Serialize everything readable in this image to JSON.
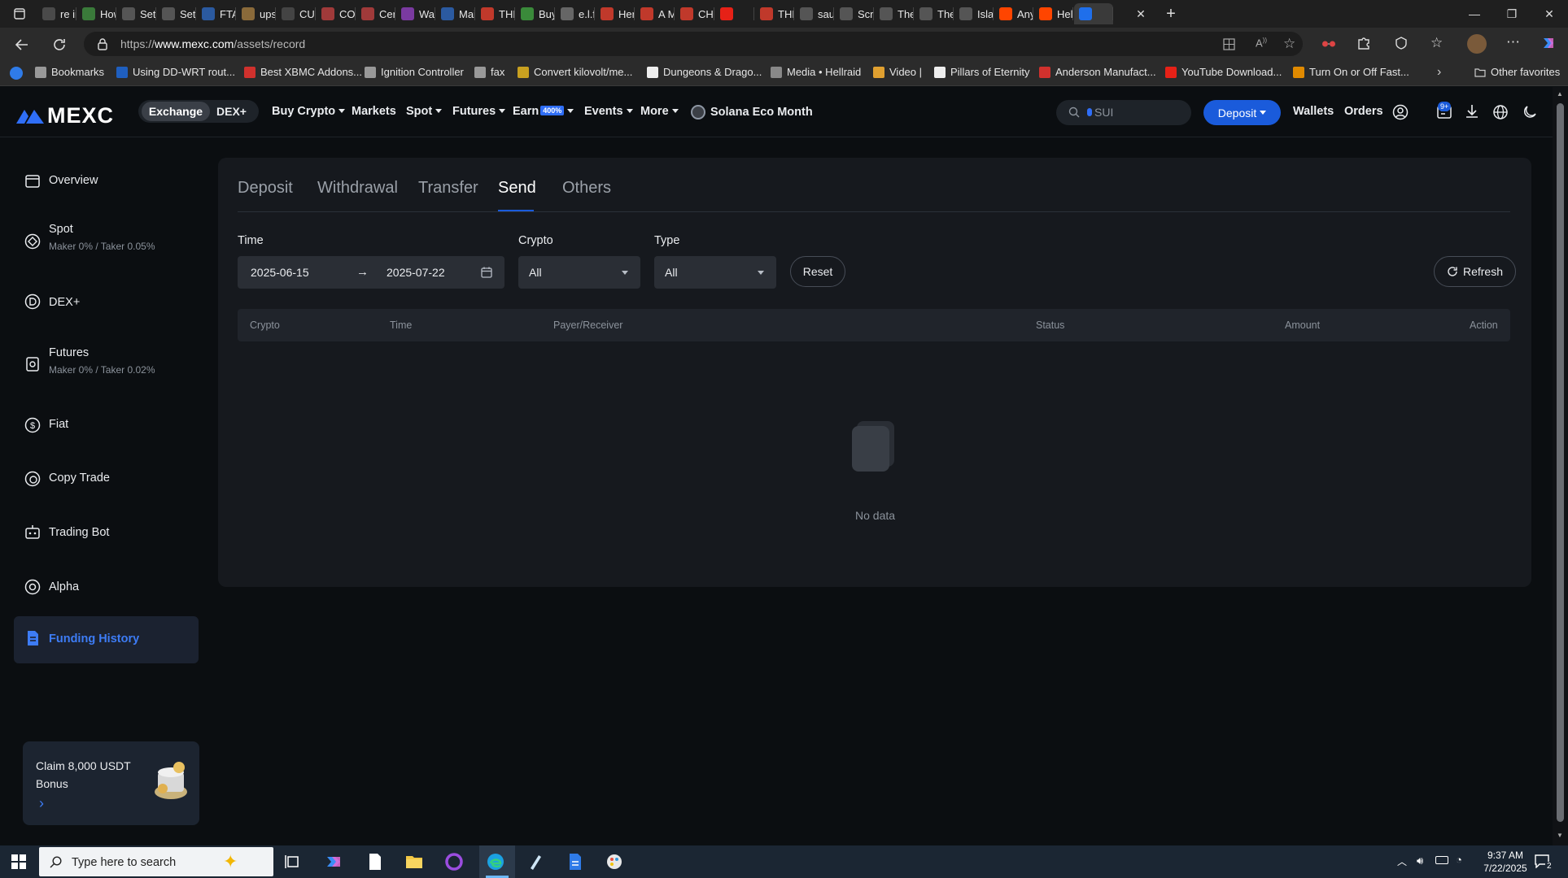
{
  "browser": {
    "tabs": [
      {
        "label": "re im",
        "color": "#4a4a4a"
      },
      {
        "label": "How",
        "color": "#3a7a3a"
      },
      {
        "label": "Setti",
        "color": "#555"
      },
      {
        "label": "Setti",
        "color": "#555"
      },
      {
        "label": "FTA C",
        "color": "#2b5aa0"
      },
      {
        "label": "ups-",
        "color": "#8a6a3a"
      },
      {
        "label": "CUSI",
        "color": "#444"
      },
      {
        "label": "COM",
        "color": "#a03a3a"
      },
      {
        "label": "Certi",
        "color": "#a03a3a"
      },
      {
        "label": "Watc",
        "color": "#7a3aa0"
      },
      {
        "label": "Mail",
        "color": "#2b5aa0"
      },
      {
        "label": "THE",
        "color": "#c0392b"
      },
      {
        "label": "Buyir",
        "color": "#3a8a3a"
      },
      {
        "label": "e.l.f.",
        "color": "#666"
      },
      {
        "label": "Here",
        "color": "#c0392b"
      },
      {
        "label": "A MI",
        "color": "#c0392b"
      },
      {
        "label": "CHO",
        "color": "#c0392b"
      },
      {
        "label": "",
        "color": "#e62117"
      },
      {
        "label": "THEI",
        "color": "#c0392b"
      },
      {
        "label": "sault",
        "color": "#555"
      },
      {
        "label": "Scrip",
        "color": "#555"
      },
      {
        "label": "The S",
        "color": "#555"
      },
      {
        "label": "The S",
        "color": "#555"
      },
      {
        "label": "Islan",
        "color": "#555"
      },
      {
        "label": "Anyc",
        "color": "#ff4500"
      },
      {
        "label": "Help",
        "color": "#ff4500"
      },
      {
        "label": "",
        "color": "#1f6feb"
      }
    ],
    "url_prefix": "https://",
    "url_host": "www.mexc.com",
    "url_path": "/assets/record",
    "bookmarks": [
      {
        "label": "Bookmarks",
        "color": "#999"
      },
      {
        "label": "Using DD-WRT rout...",
        "color": "#1f5fbf"
      },
      {
        "label": "Best XBMC Addons...",
        "color": "#d0312d"
      },
      {
        "label": "Ignition Controller",
        "color": "#999"
      },
      {
        "label": "fax",
        "color": "#999"
      },
      {
        "label": "Convert kilovolt/me...",
        "color": "#c8a020"
      },
      {
        "label": "Dungeons & Drago...",
        "color": "#eee"
      },
      {
        "label": "Media • Hellraid",
        "color": "#888"
      },
      {
        "label": "Video |",
        "color": "#e0a030"
      },
      {
        "label": "Pillars of Eternity",
        "color": "#eee"
      },
      {
        "label": "Anderson Manufact...",
        "color": "#d0312d"
      },
      {
        "label": "YouTube Download...",
        "color": "#e62117"
      },
      {
        "label": "Turn On or Off Fast...",
        "color": "#e08a00"
      }
    ],
    "other_favorites": "Other favorites"
  },
  "header": {
    "logo": "MEXC",
    "toggle": [
      "Exchange",
      "DEX+"
    ],
    "nav": [
      "Buy Crypto",
      "Markets",
      "Spot",
      "Futures",
      "Earn",
      "Events",
      "More",
      "Solana Eco Month"
    ],
    "earn_badge": "400%",
    "search_placeholder": "SUI",
    "deposit": "Deposit",
    "wallets": "Wallets",
    "orders": "Orders",
    "notif_badge": "9+"
  },
  "sidebar": {
    "items": [
      {
        "label": "Overview",
        "sub": ""
      },
      {
        "label": "Spot",
        "sub": "Maker 0% / Taker 0.05%"
      },
      {
        "label": "DEX+",
        "sub": ""
      },
      {
        "label": "Futures",
        "sub": "Maker 0% / Taker 0.02%"
      },
      {
        "label": "Fiat",
        "sub": ""
      },
      {
        "label": "Copy Trade",
        "sub": ""
      },
      {
        "label": "Trading Bot",
        "sub": ""
      },
      {
        "label": "Alpha",
        "sub": ""
      },
      {
        "label": "Funding History",
        "sub": ""
      }
    ],
    "active_index": 8,
    "promo_line1": "Claim 8,000 USDT",
    "promo_line2": "Bonus"
  },
  "records": {
    "tabs": [
      "Deposit",
      "Withdrawal",
      "Transfer",
      "Send",
      "Others"
    ],
    "active_tab": "Send",
    "time_label": "Time",
    "start_date": "2025-06-15",
    "end_date": "2025-07-22",
    "crypto_label": "Crypto",
    "crypto_value": "All",
    "type_label": "Type",
    "type_value": "All",
    "reset": "Reset",
    "refresh": "Refresh",
    "columns": [
      "Crypto",
      "Time",
      "Payer/Receiver",
      "Status",
      "Amount",
      "Action"
    ],
    "empty_text": "No data"
  },
  "taskbar": {
    "search_placeholder": "Type here to search",
    "time": "9:37 AM",
    "date": "7/22/2025",
    "notif_count": "2"
  },
  "colors": {
    "accent": "#1a5bdb",
    "active_nav_bg": "#1b2230",
    "active_nav_text": "#3d7cf5",
    "card_bg": "#16191e",
    "page_bg": "#0b0e11"
  }
}
